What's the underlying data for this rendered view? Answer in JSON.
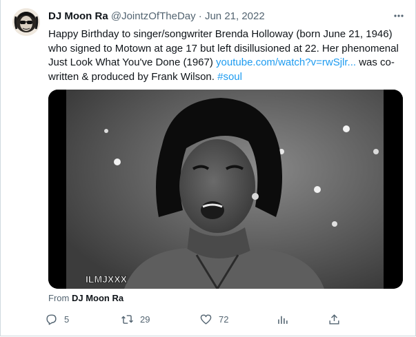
{
  "tweet": {
    "display_name": "DJ Moon Ra",
    "handle": "@JointzOfTheDay",
    "separator": "·",
    "date": "Jun 21, 2022",
    "text_main": "Happy Birthday to singer/songwriter Brenda Holloway (born June 21, 1946) who signed to Motown at age 17 but left disillusioned at 22. Her phenomenal Just Look What You've Done (1967) ",
    "link_text": "youtube.com/watch?v=rwSjlr...",
    "text_after_link": " was co-written & produced by Frank Wilson. ",
    "hashtag": "#soul"
  },
  "media": {
    "watermark": "ILMJXXX"
  },
  "source": {
    "prefix": "From",
    "name": "DJ Moon Ra"
  },
  "actions": {
    "replies": "5",
    "retweets": "29",
    "likes": "72"
  },
  "icons": {
    "more": "more-dots-icon",
    "reply": "reply-icon",
    "retweet": "retweet-icon",
    "like": "heart-icon",
    "analytics": "analytics-icon",
    "share": "share-icon"
  },
  "colors": {
    "link": "#1d9bf0",
    "secondary_text": "#536471"
  }
}
